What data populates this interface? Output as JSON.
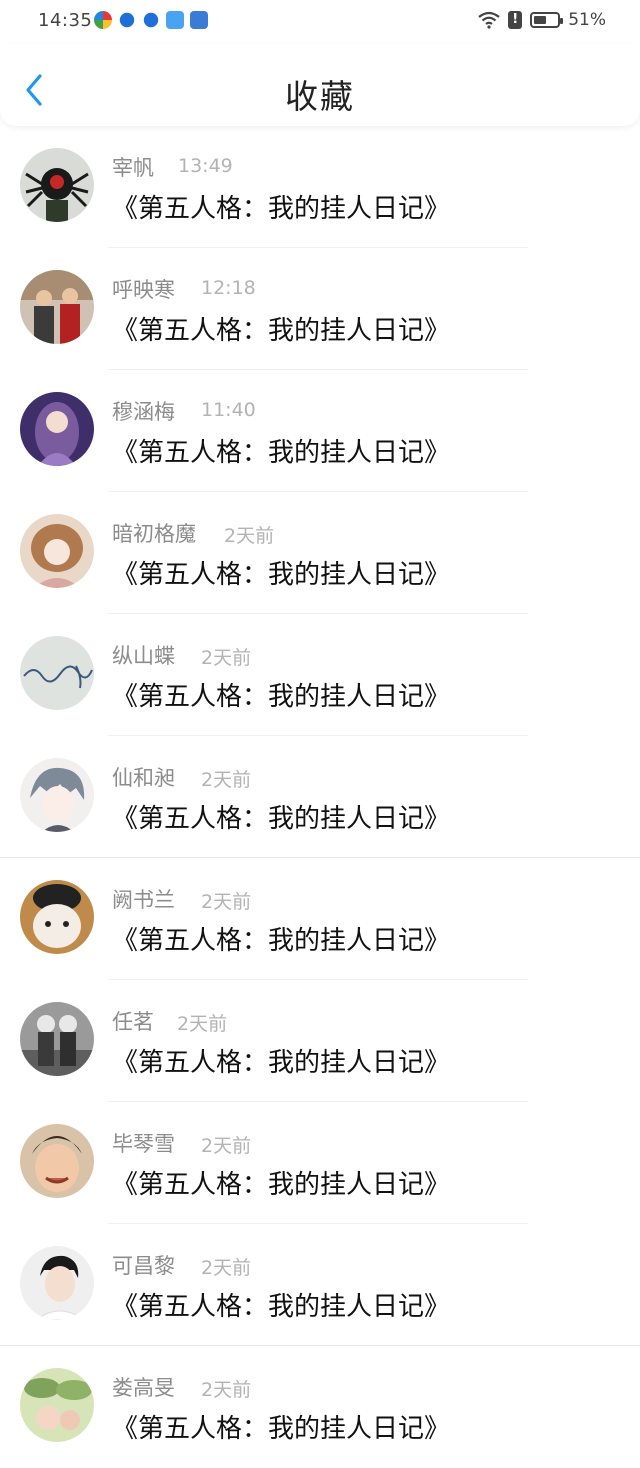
{
  "status": {
    "time": "14:35",
    "battery": "51%",
    "icons": [
      "pinwheel-app-icon",
      "blue-bird-app-icon",
      "blue-bird-app-icon-2",
      "weather-app-icon",
      "email-app-icon",
      "wifi-icon",
      "alert-icon",
      "battery-icon"
    ]
  },
  "header": {
    "back_icon": "chevron-left-icon",
    "title": "收藏"
  },
  "colors": {
    "accent": "#2196f3",
    "name_gray": "#8c8c8c",
    "time_gray": "#b3b3b3"
  },
  "items": [
    {
      "name": "宰帆",
      "time": "13:49",
      "subject": "《第五人格：我的挂人日记》"
    },
    {
      "name": "呼映寒",
      "time": "12:18",
      "subject": "《第五人格：我的挂人日记》"
    },
    {
      "name": "穆涵梅",
      "time": "11:40",
      "subject": "《第五人格：我的挂人日记》"
    },
    {
      "name": "暗初格魔",
      "time": "2天前",
      "subject": "《第五人格：我的挂人日记》"
    },
    {
      "name": "纵山蝶",
      "time": "2天前",
      "subject": "《第五人格：我的挂人日记》"
    },
    {
      "name": "仙和昶",
      "time": "2天前",
      "subject": "《第五人格：我的挂人日记》"
    },
    {
      "name": "阙书兰",
      "time": "2天前",
      "subject": "《第五人格：我的挂人日记》"
    },
    {
      "name": "任茗",
      "time": "2天前",
      "subject": "《第五人格：我的挂人日记》"
    },
    {
      "name": "毕琴雪",
      "time": "2天前",
      "subject": "《第五人格：我的挂人日记》"
    },
    {
      "name": "可昌黎",
      "time": "2天前",
      "subject": "《第五人格：我的挂人日记》"
    },
    {
      "name": "娄高旻",
      "time": "2天前",
      "subject": "《第五人格：我的挂人日记》"
    }
  ]
}
